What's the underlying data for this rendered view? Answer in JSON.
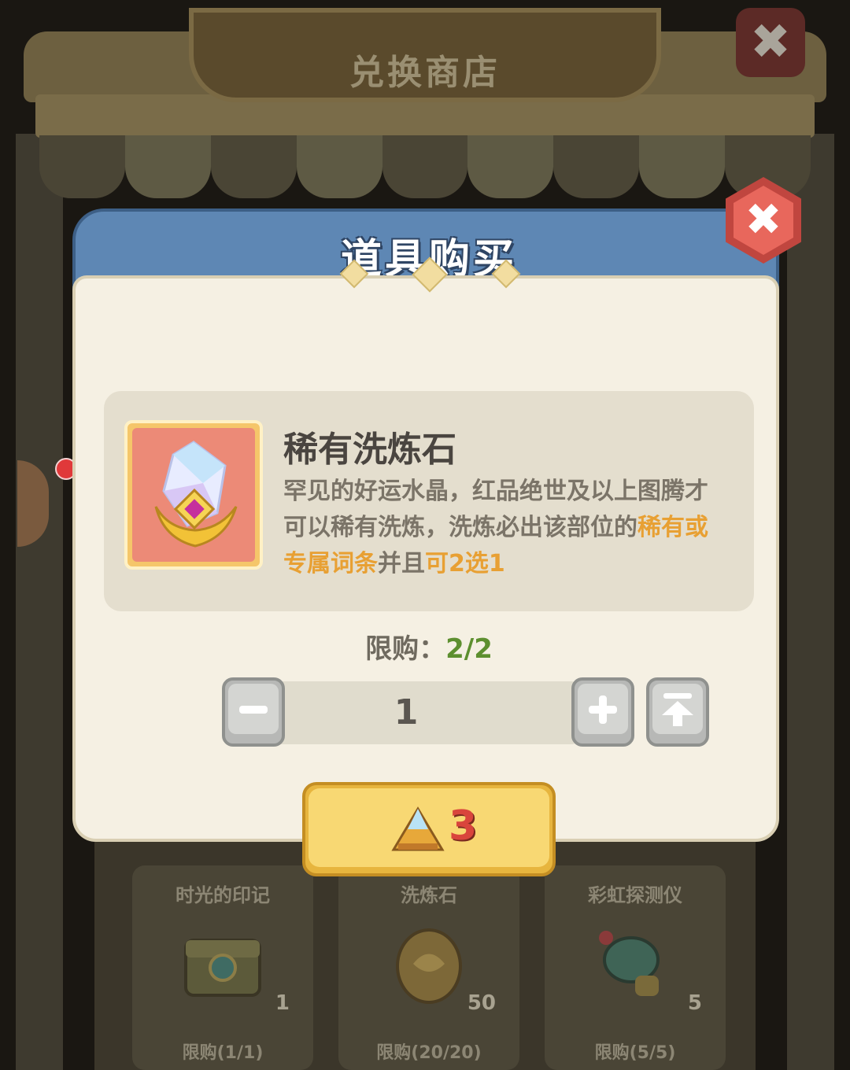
{
  "shop": {
    "title": "兑换商店",
    "items": [
      {
        "name": "时光的印记",
        "count": "1",
        "limit": "限购(1/1)"
      },
      {
        "name": "洗炼石",
        "count": "50",
        "limit": "限购(20/20)"
      },
      {
        "name": "彩虹探测仪",
        "count": "5",
        "limit": "限购(5/5)"
      }
    ]
  },
  "dialog": {
    "title": "道具购买",
    "item": {
      "name": "稀有洗炼石",
      "desc_part1": "罕见的好运水晶，红品绝世及以上图腾才可以稀有洗炼，洗炼必出该部位的",
      "desc_highlight1": "稀有或专属词条",
      "desc_part2": "并且",
      "desc_highlight2": "可2选1"
    },
    "limit_label": "限购：",
    "limit_value": "2/2",
    "quantity": "1",
    "price": "3"
  },
  "colors": {
    "header_blue": "#5e87b4",
    "buy_yellow": "#f8d873",
    "price_red": "#d9453c",
    "highlight_orange": "#e8a033",
    "limit_green": "#5d8f2f"
  },
  "icons": [
    "close-icon",
    "crystal-icon",
    "minus-icon",
    "plus-icon",
    "max-icon",
    "pyramid-currency-icon"
  ]
}
